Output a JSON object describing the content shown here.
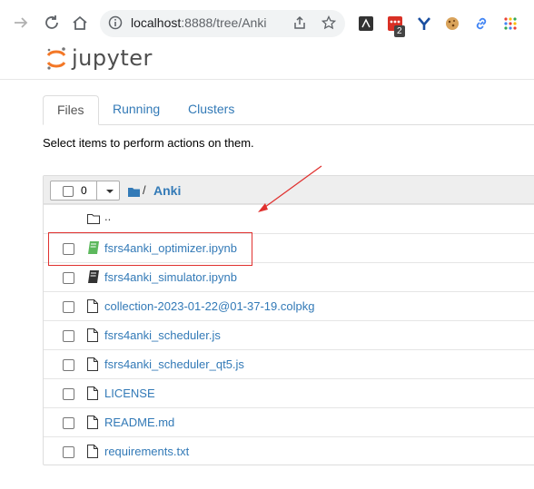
{
  "browser": {
    "url_host": "localhost",
    "url_rest": ":8888/tree/Anki",
    "extension_badge": "2",
    "icons": [
      "arrow-right-icon",
      "reload-icon",
      "home-icon",
      "info-icon",
      "share-icon",
      "star-icon",
      "terminal-extension-icon",
      "red-extension-icon",
      "fork-icon",
      "cookie-icon",
      "link-icon",
      "grid-icon"
    ]
  },
  "jupyter": {
    "wordmark": "jupyter"
  },
  "tabs": [
    {
      "label": "Files",
      "active": true
    },
    {
      "label": "Running"
    },
    {
      "label": "Clusters"
    }
  ],
  "hint": "Select items to perform actions on them.",
  "list_header": {
    "selected_count": "0",
    "separator": "/",
    "folder_name": "Anki"
  },
  "parent_dir": "..",
  "files": [
    {
      "name": "fsrs4anki_optimizer.ipynb",
      "type": "notebook-running"
    },
    {
      "name": "fsrs4anki_simulator.ipynb",
      "type": "notebook"
    },
    {
      "name": "collection-2023-01-22@01-37-19.colpkg",
      "type": "file"
    },
    {
      "name": "fsrs4anki_scheduler.js",
      "type": "file"
    },
    {
      "name": "fsrs4anki_scheduler_qt5.js",
      "type": "file"
    },
    {
      "name": "LICENSE",
      "type": "file"
    },
    {
      "name": "README.md",
      "type": "file"
    },
    {
      "name": "requirements.txt",
      "type": "file"
    }
  ],
  "colors": {
    "link": "#337ab7",
    "annotation": "#e0312f",
    "running_notebook": "#5cb85c"
  }
}
